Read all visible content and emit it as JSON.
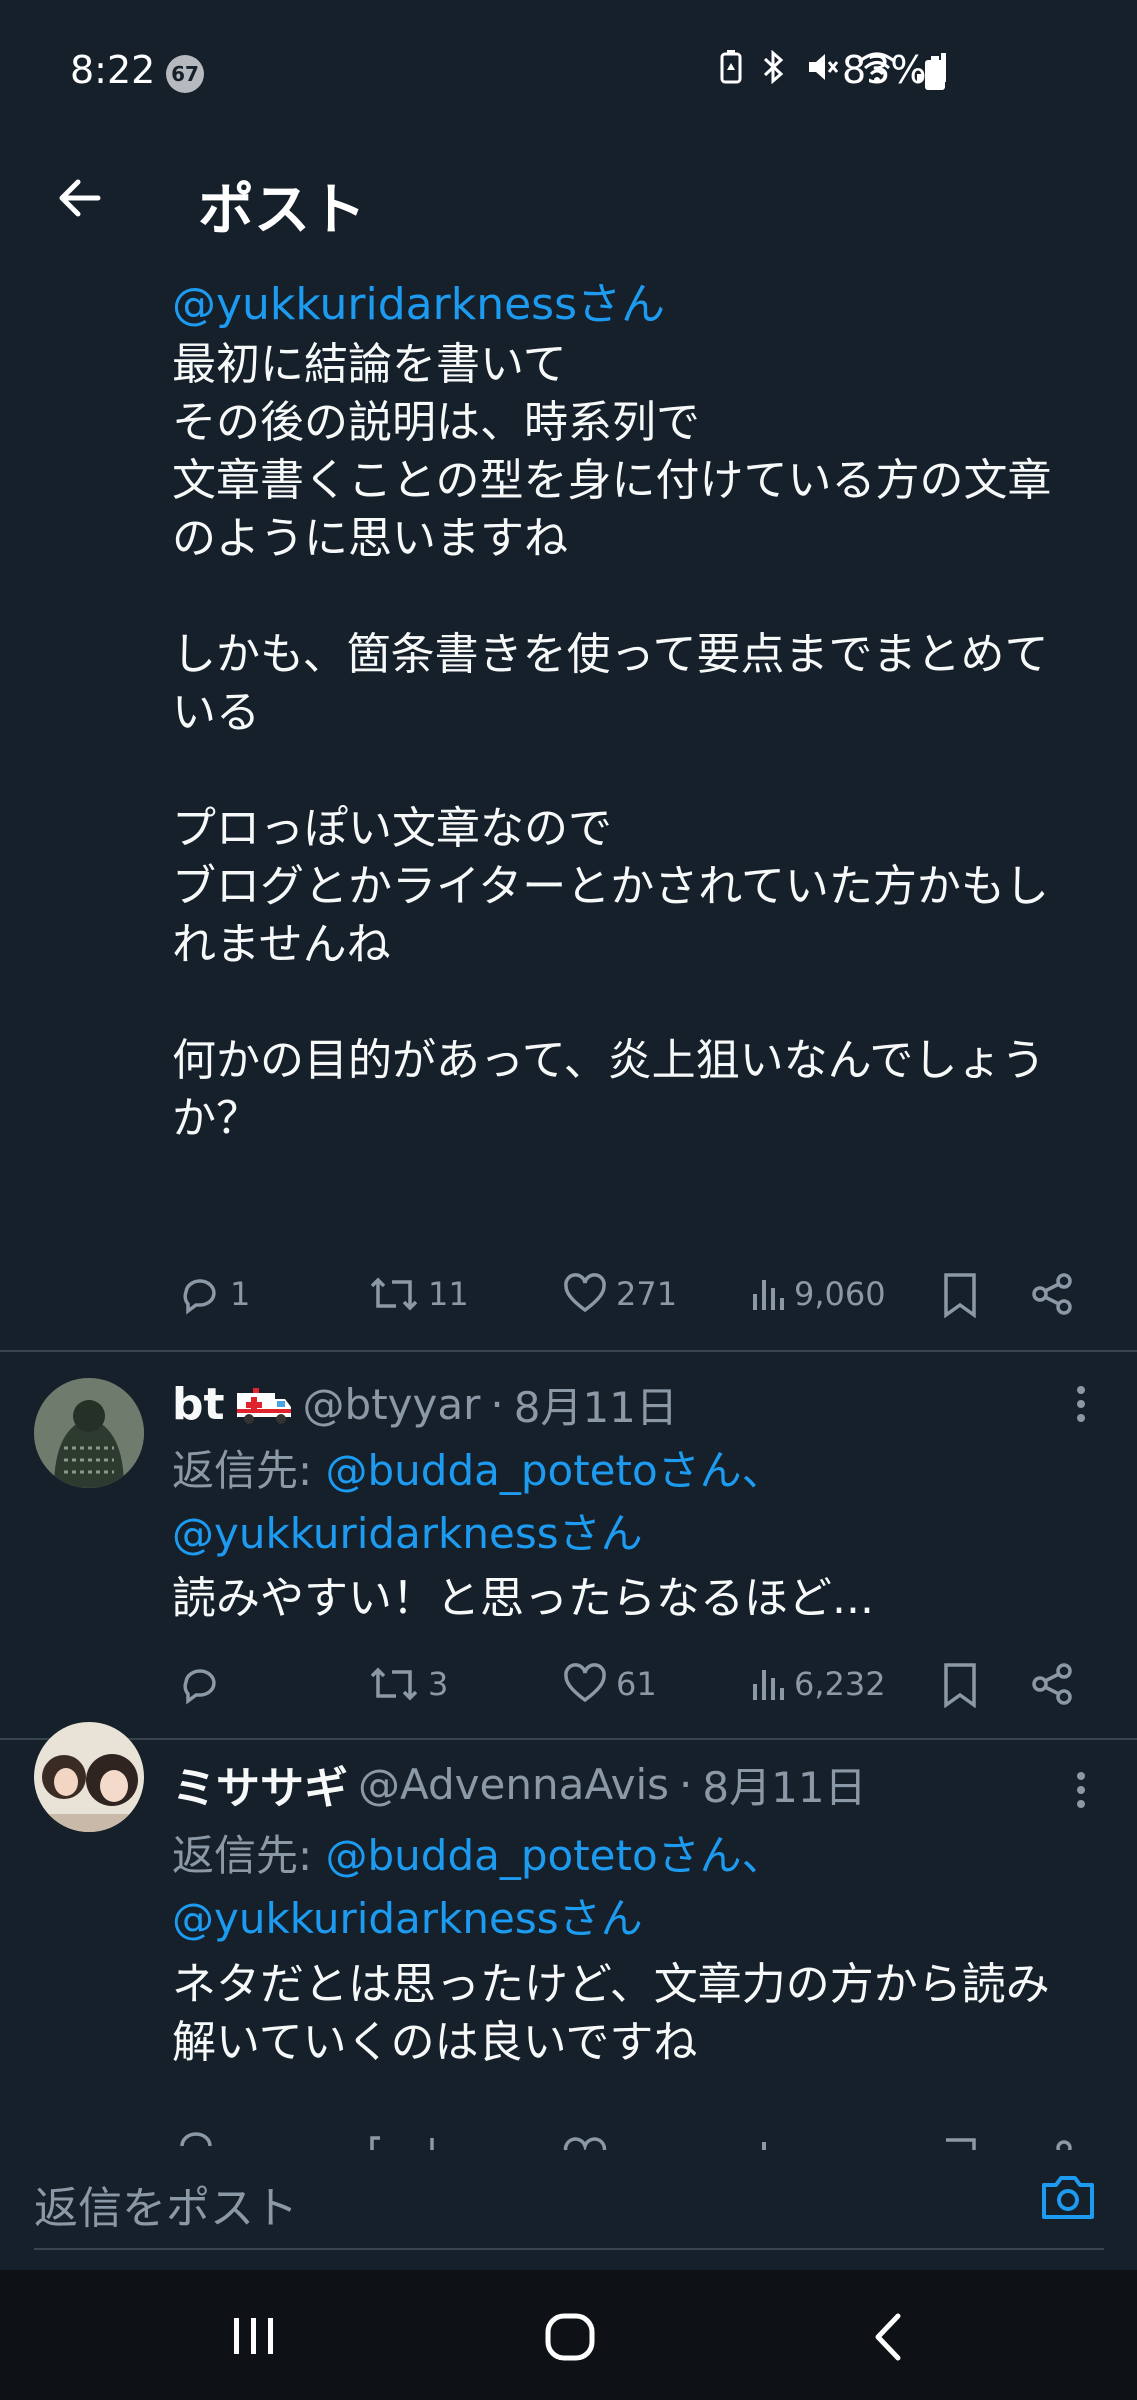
{
  "status_bar": {
    "time": "8:22",
    "notification_count": "67",
    "battery_percent": "83%"
  },
  "header": {
    "title": "ポスト"
  },
  "tweet_main": {
    "reply_to_mention": "@yukkuridarknessさん",
    "body": "最初に結論を書いて\nその後の説明は、時系列で\n文章書くことの型を身に付けている方の文章\nのように思いますね\n\nしかも、箇条書きを使って要点までまとめて\nいる\n\nプロっぽい文章なので\nブログとかライターとかされていた方かもし\nれませんね\n\n何かの目的があって、炎上狙いなんでしょう\nか？",
    "replies": "1",
    "retweets": "11",
    "likes": "271",
    "views": "9,060"
  },
  "tweet_bt": {
    "name": "bt",
    "handle": "@btyyar",
    "separator": "·",
    "date": "8月11日",
    "reply_label": "返信先:",
    "mention1": "@budda_potetoさん、",
    "mention2": "@yukkuridarknessさん",
    "body": "読みやすい！と思ったらなるほど...",
    "replies": "",
    "retweets": "3",
    "likes": "61",
    "views": "6,232"
  },
  "tweet_misasagi": {
    "name": "ミササギ",
    "handle": "@AdvennaAvis",
    "separator": "·",
    "date": "8月11日",
    "reply_label": "返信先:",
    "mention1": "@budda_potetoさん、",
    "mention2": "@yukkuridarknessさん",
    "body": "ネタだとは思ったけど、文章力の方から読み\n解いていくのは良いですね"
  },
  "reply_bar": {
    "placeholder": "返信をポスト"
  },
  "colors": {
    "background": "#15202b",
    "accent": "#1d9bf0",
    "muted": "#8b98a5"
  }
}
